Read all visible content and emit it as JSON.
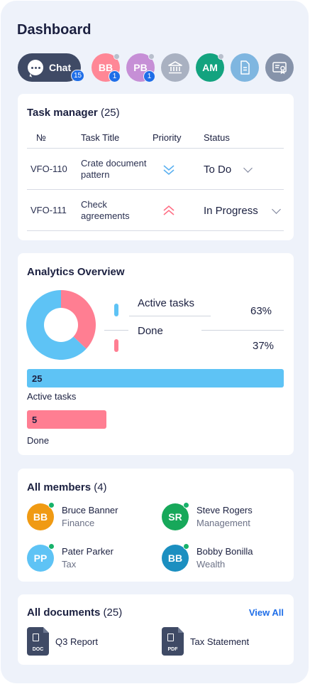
{
  "header": {
    "title": "Dashboard"
  },
  "chat": {
    "label": "Chat",
    "badge": "15"
  },
  "quick_chips": [
    {
      "initials": "BB",
      "badge": "1",
      "color": "#ff8796"
    },
    {
      "initials": "PB",
      "badge": "1",
      "color": "#c68fd6"
    },
    {
      "icon": "bank-icon",
      "color": "#a9b1c1"
    },
    {
      "initials": "AM",
      "color": "#13a37f"
    },
    {
      "icon": "document-icon",
      "color": "#7fb6e0"
    },
    {
      "icon": "certificate-icon",
      "color": "#8693aa"
    }
  ],
  "task_manager": {
    "title": "Task manager",
    "count": "(25)",
    "columns": [
      "№",
      "Task Title",
      "Priority",
      "Status"
    ],
    "rows": [
      {
        "id": "VFO-110",
        "title_line1": "Crate document",
        "title_line2": "pattern",
        "priority": "low",
        "status": "To Do"
      },
      {
        "id": "VFO-111",
        "title_line1": "Check",
        "title_line2": "agreements",
        "priority": "high",
        "status": "In Progress"
      }
    ]
  },
  "analytics": {
    "title": "Analytics Overview",
    "legend": [
      {
        "label": "Active tasks",
        "percent": "63%",
        "color": "#5ec3f5"
      },
      {
        "label": "Done",
        "percent": "37%",
        "color": "#ff7e92"
      }
    ],
    "bars": [
      {
        "value": "25",
        "label": "Active tasks",
        "color": "#5ec3f5",
        "fraction": 1.0
      },
      {
        "value": "5",
        "label": "Done",
        "color": "#ff7e92",
        "fraction": 0.31
      }
    ]
  },
  "members": {
    "title": "All members",
    "count": "(4)",
    "list": [
      {
        "initials": "BB",
        "name": "Bruce Banner",
        "role": "Finance",
        "color": "#f09a13"
      },
      {
        "initials": "SR",
        "name": "Steve Rogers",
        "role": "Management",
        "color": "#17a85a"
      },
      {
        "initials": "PP",
        "name": "Pater Parker",
        "role": "Tax",
        "color": "#5ec3f5"
      },
      {
        "initials": "BB",
        "name": "Bobby Bonilla",
        "role": "Wealth",
        "color": "#1b8fc0"
      }
    ]
  },
  "documents": {
    "title": "All documents",
    "count": "(25)",
    "view_all": "View All",
    "files": [
      {
        "ext": "DOC",
        "name": "Q3 Report"
      },
      {
        "ext": "PDF",
        "name": "Tax Statement"
      }
    ]
  }
}
